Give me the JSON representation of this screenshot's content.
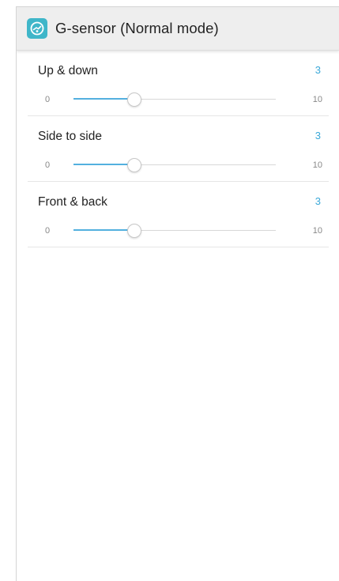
{
  "header": {
    "title": "G-sensor (Normal mode)",
    "icon": "g-sensor-app-icon",
    "icon_color": "#3fb6c9"
  },
  "accent_color": "#53b0df",
  "settings": [
    {
      "label": "Up & down",
      "value": "3",
      "min": "0",
      "max": "10",
      "level": 0.3
    },
    {
      "label": "Side to side",
      "value": "3",
      "min": "0",
      "max": "10",
      "level": 0.3
    },
    {
      "label": "Front & back",
      "value": "3",
      "min": "0",
      "max": "10",
      "level": 0.3
    }
  ]
}
